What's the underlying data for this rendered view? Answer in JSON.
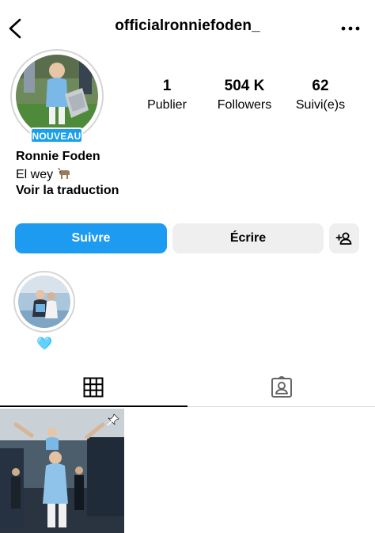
{
  "header": {
    "username": "officialronniefoden_"
  },
  "profile": {
    "badge": "NOUVEAU",
    "display_name": "Ronnie Foden",
    "bio": "El wey",
    "bio_emoji": "goat-emoji",
    "translate_link": "Voir la traduction"
  },
  "stats": [
    {
      "value": "1",
      "label": "Publier"
    },
    {
      "value": "504 K",
      "label": "Followers"
    },
    {
      "value": "62",
      "label": "Suivi(e)s"
    }
  ],
  "actions": {
    "follow": "Suivre",
    "message": "Écrire"
  },
  "highlight": {
    "label": "🩵"
  },
  "colors": {
    "accent": "#1d9bf0",
    "badge": "#1aa0e8",
    "button_secondary": "#efefef"
  }
}
